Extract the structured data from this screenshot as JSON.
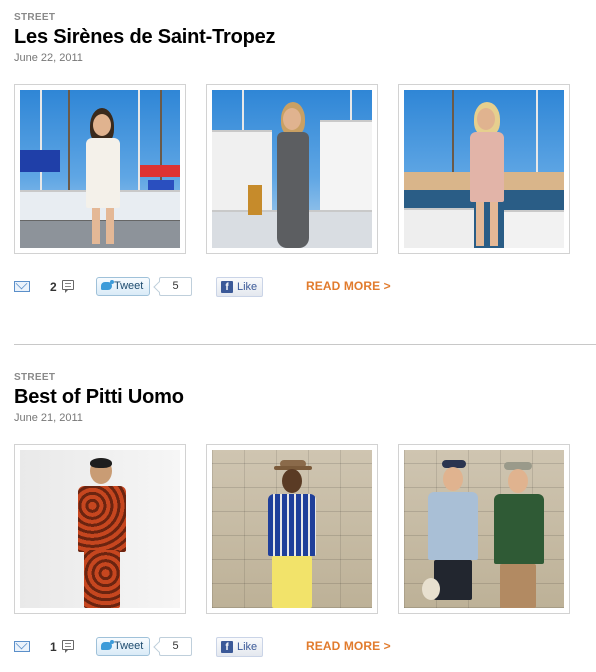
{
  "posts": [
    {
      "category": "STREET",
      "title": "Les Sirènes de Saint-Tropez",
      "date": "June 22, 2011",
      "comments": "2",
      "tweet_label": "Tweet",
      "tweet_count": "5",
      "like_label": "Like",
      "read_more": "READ MORE >",
      "photos": [
        {
          "subject": "woman in white lace dress at harbor",
          "icon": "photo-icon"
        },
        {
          "subject": "woman in gray maxi dress on dock",
          "icon": "photo-icon"
        },
        {
          "subject": "woman in pink ruffled romper by boats",
          "icon": "photo-icon"
        }
      ]
    },
    {
      "category": "STREET",
      "title": "Best of Pitti Uomo",
      "date": "June 21, 2011",
      "comments": "1",
      "tweet_label": "Tweet",
      "tweet_count": "5",
      "like_label": "Like",
      "read_more": "READ MORE >",
      "photos": [
        {
          "subject": "man in orange floral suit against white wall",
          "icon": "photo-icon"
        },
        {
          "subject": "man in blue knit shirt and yellow trousers with hat",
          "icon": "photo-icon"
        },
        {
          "subject": "two men in light blue and green jackets with hats",
          "icon": "photo-icon"
        }
      ]
    }
  ],
  "colors": {
    "read_more": "#e17b2d",
    "category": "#8a8a8a",
    "facebook": "#3b5998",
    "twitter": "#3d9bd9"
  },
  "icons": [
    "mail-icon",
    "comment-icon",
    "twitter-bird-icon",
    "facebook-icon"
  ]
}
